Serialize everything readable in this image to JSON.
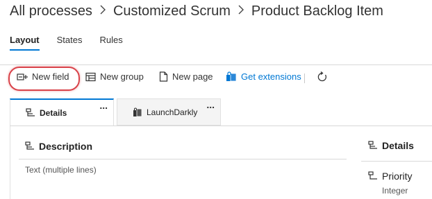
{
  "breadcrumb": [
    "All processes",
    "Customized Scrum",
    "Product Backlog Item"
  ],
  "tabs": [
    {
      "label": "Layout",
      "active": true
    },
    {
      "label": "States",
      "active": false
    },
    {
      "label": "Rules",
      "active": false
    }
  ],
  "toolbar": {
    "new_field": "New field",
    "new_group": "New group",
    "new_page": "New page",
    "get_extensions": "Get extensions",
    "refresh_icon": "refresh-icon"
  },
  "page_tabs": [
    {
      "label": "Details",
      "active": true,
      "more": "..."
    },
    {
      "label": "LaunchDarkly",
      "active": false,
      "more": "..."
    }
  ],
  "groups": {
    "description": {
      "title": "Description",
      "field_type": "Text (multiple lines)"
    },
    "details": {
      "title": "Details",
      "field_label": "Priority",
      "field_type": "Integer"
    }
  },
  "colors": {
    "accent": "#0078d4",
    "highlight": "#d9434a"
  }
}
